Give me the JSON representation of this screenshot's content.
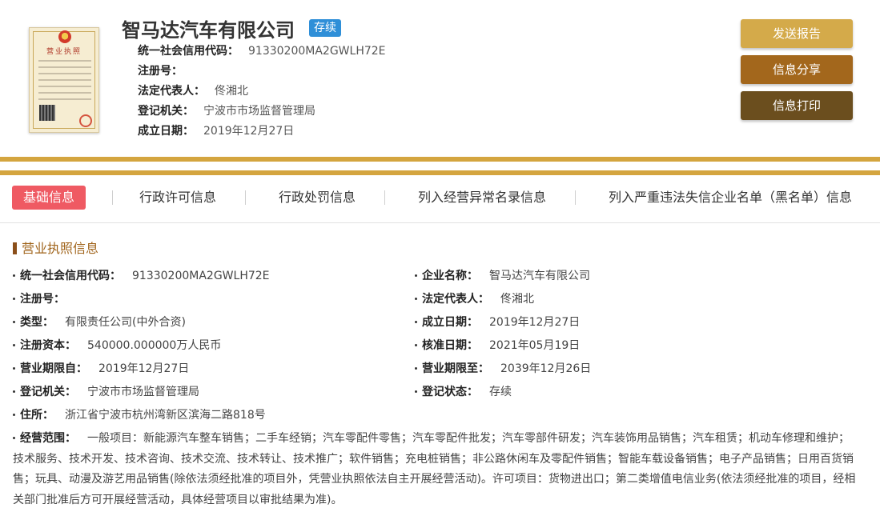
{
  "header": {
    "license_thumb_title": "营业执照",
    "company_name": "智马达汽车有限公司",
    "status_tag": "存续",
    "fields": [
      {
        "label": "统一社会信用代码：",
        "value": "91330200MA2GWLH72E"
      },
      {
        "label": "注册号：",
        "value": ""
      },
      {
        "label": "法定代表人：",
        "value": "佟湘北"
      },
      {
        "label": "登记机关：",
        "value": "宁波市市场监督管理局"
      },
      {
        "label": "成立日期：",
        "value": "2019年12月27日"
      }
    ],
    "buttons": {
      "send": "发送报告",
      "share": "信息分享",
      "print": "信息打印"
    }
  },
  "tabs": [
    {
      "label": "基础信息",
      "active": true
    },
    {
      "label": "行政许可信息",
      "active": false
    },
    {
      "label": "行政处罚信息",
      "active": false
    },
    {
      "label": "列入经营异常名录信息",
      "active": false
    },
    {
      "label": "列入严重违法失信企业名单（黑名单）信息",
      "active": false
    }
  ],
  "section": {
    "title": "营业执照信息",
    "left": [
      {
        "label": "统一社会信用代码：",
        "value": "91330200MA2GWLH72E"
      },
      {
        "label": "注册号：",
        "value": ""
      },
      {
        "label": "类型：",
        "value": "有限责任公司(中外合资)"
      },
      {
        "label": "注册资本：",
        "value": "540000.000000万人民币"
      },
      {
        "label": "营业期限自：",
        "value": "2019年12月27日"
      },
      {
        "label": "登记机关：",
        "value": "宁波市市场监督管理局"
      },
      {
        "label": "住所：",
        "value": "浙江省宁波市杭州湾新区滨海二路818号"
      }
    ],
    "right": [
      {
        "label": "企业名称：",
        "value": "智马达汽车有限公司"
      },
      {
        "label": "法定代表人：",
        "value": "佟湘北"
      },
      {
        "label": "成立日期：",
        "value": "2019年12月27日"
      },
      {
        "label": "核准日期：",
        "value": "2021年05月19日"
      },
      {
        "label": "营业期限至：",
        "value": "2039年12月26日"
      },
      {
        "label": "登记状态：",
        "value": "存续"
      }
    ],
    "scope": {
      "label": "经营范围：",
      "value": "一般项目：新能源汽车整车销售；二手车经销；汽车零配件零售；汽车零配件批发；汽车零部件研发；汽车装饰用品销售；汽车租赁；机动车修理和维护；技术服务、技术开发、技术咨询、技术交流、技术转让、技术推广；软件销售；充电桩销售；非公路休闲车及零配件销售；智能车载设备销售；电子产品销售；日用百货销售；玩具、动漫及游艺用品销售(除依法须经批准的项目外，凭营业执照依法自主开展经营活动)。许可项目：货物进出口；第二类增值电信业务(依法须经批准的项目，经相关部门批准后方可开展经营活动，具体经营项目以审批结果为准)。"
    }
  },
  "colors": {
    "gold_bar": "#d4a53f",
    "btn_send": "#d4aa4a",
    "btn_share": "#a3671c",
    "btn_print": "#6b4e1e",
    "tab_active": "#ef5a63",
    "status_tag": "#2f8fd8",
    "section_title": "#a0641b"
  }
}
